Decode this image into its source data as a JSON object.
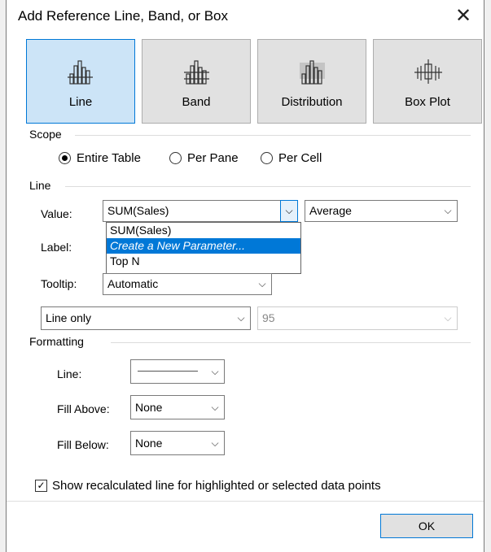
{
  "window": {
    "title": "Add Reference Line, Band, or Box",
    "close_symbol": "✕"
  },
  "types": [
    {
      "label": "Line",
      "icon": "line-chart-icon",
      "selected": true
    },
    {
      "label": "Band",
      "icon": "band-chart-icon",
      "selected": false
    },
    {
      "label": "Distribution",
      "icon": "distribution-chart-icon",
      "selected": false
    },
    {
      "label": "Box Plot",
      "icon": "box-plot-icon",
      "selected": false
    }
  ],
  "scope": {
    "heading": "Scope",
    "options": [
      {
        "label": "Entire Table",
        "checked": true
      },
      {
        "label": "Per Pane",
        "checked": false
      },
      {
        "label": "Per Cell",
        "checked": false
      }
    ]
  },
  "line": {
    "heading": "Line",
    "value_label": "Value:",
    "value_selected": "SUM(Sales)",
    "aggregation": "Average",
    "dropdown_items": [
      "SUM(Sales)",
      "Create a New Parameter...",
      "Top N"
    ],
    "label_label": "Label:",
    "tooltip_label": "Tooltip:",
    "tooltip_value": "Automatic",
    "line_mode": "Line only",
    "confidence": "95"
  },
  "formatting": {
    "heading": "Formatting",
    "line_label": "Line:",
    "fill_above_label": "Fill Above:",
    "fill_above_value": "None",
    "fill_below_label": "Fill Below:",
    "fill_below_value": "None"
  },
  "recalc": {
    "label": "Show recalculated line for highlighted or selected data points",
    "checked": true
  },
  "ok_label": "OK",
  "colors": {
    "accent": "#0078d7",
    "selected_bg": "#cce4f7"
  }
}
